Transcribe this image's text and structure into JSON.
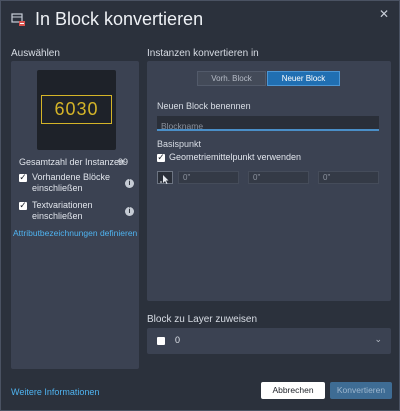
{
  "dialog": {
    "title": "In Block konvertieren",
    "close_glyph": "✕"
  },
  "left": {
    "section_label": "Auswählen",
    "preview_text": "6030",
    "instances_label": "Gesamtzahl der Instanzen",
    "instances_count": "99",
    "include_existing_label_1": "Vorhandene Blöcke",
    "include_existing_label_2": "einschließen",
    "include_existing_checked": true,
    "include_text_label_1": "Textvariationen",
    "include_text_label_2": "einschließen",
    "include_text_checked": true,
    "attribute_link": "Attributbezeichnungen definieren"
  },
  "right": {
    "section_label": "Instanzen konvertieren in",
    "tab_previous": "Vorh. Block",
    "tab_new": "Neuer Block",
    "active_tab": "Neuer Block",
    "name_label": "Neuen Block benennen",
    "name_placeholder": "Blockname",
    "name_value": "",
    "basepoint_label": "Basispunkt",
    "geometric_center_label": "Geometriemittelpunkt verwenden",
    "geometric_center_checked": true,
    "coords": [
      "0\"",
      "0\"",
      "0\""
    ]
  },
  "layer": {
    "section_label": "Block zu Layer zuweisen",
    "selected": "0",
    "swatch_color": "#ffffff"
  },
  "footer": {
    "more_info": "Weitere Informationen",
    "cancel": "Abbrechen",
    "convert": "Konvertieren"
  },
  "colors": {
    "accent": "#206fb2",
    "link": "#4fb3f0",
    "preview_text": "#d4b428"
  }
}
